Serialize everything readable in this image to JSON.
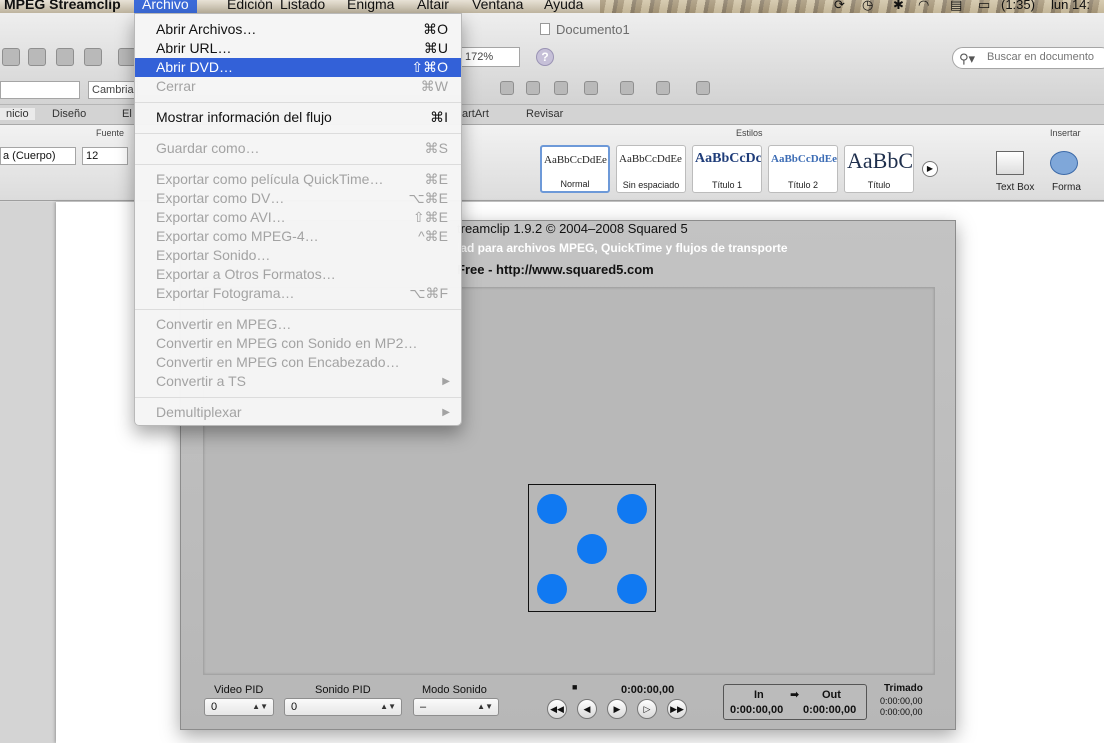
{
  "menubar": {
    "app": "MPEG Streamclip",
    "items": [
      "Archivo",
      "Edición",
      "Listado",
      "Enigma",
      "Altair",
      "Ventana",
      "Ayuda"
    ],
    "battery": "(1:35)",
    "clock": "lun 14:"
  },
  "word": {
    "doc_title": "Documento1",
    "zoom": "172%",
    "search_placeholder": "Buscar en documento",
    "font_name": "Cambria",
    "font_name2": "a (Cuerpo)",
    "font_size": "12",
    "tabs": [
      "nicio",
      "Diseño",
      "El",
      "artArt",
      "Revisar"
    ],
    "group_fuente": "Fuente",
    "group_estilos": "Estilos",
    "group_insertar": "Insertar",
    "styles": [
      {
        "sample": "AaBbCcDdEe",
        "caption": "Normal"
      },
      {
        "sample": "AaBbCcDdEe",
        "caption": "Sin espaciado"
      },
      {
        "sample": "AaBbCcDc",
        "caption": "Título 1"
      },
      {
        "sample": "AaBbCcDdEe",
        "caption": "Título 2"
      },
      {
        "sample": "AaBbC",
        "caption": "Título"
      }
    ],
    "insert_textbox": "Text Box",
    "insert_forma": "Forma"
  },
  "streamclip": {
    "line1": "treamclip 1.9.2 © 2004–2008 Squared 5",
    "line2": "lad para archivos MPEG, QuickTime y flujos de transporte",
    "line3": "Free  -  http://www.squared5.com",
    "video_pid_label": "Video PID",
    "video_pid_value": "0",
    "audio_pid_label": "Sonido PID",
    "audio_pid_value": "0",
    "audio_mode_label": "Modo Sonido",
    "audio_mode_value": "–",
    "timecode": "0:00:00,00",
    "in_label": "In",
    "out_label": "Out",
    "in_value": "0:00:00,00",
    "out_value": "0:00:00,00",
    "trim_label": "Trimado",
    "trim_value1": "0:00:00,00",
    "trim_value2": "0:00:00,00",
    "pip_color": "#1079f2"
  },
  "file_menu": {
    "items": [
      {
        "label": "Abrir Archivos…",
        "shortcut": "⌘O",
        "state": "enabled"
      },
      {
        "label": "Abrir URL…",
        "shortcut": "⌘U",
        "state": "enabled"
      },
      {
        "label": "Abrir DVD…",
        "shortcut": "⇧⌘O",
        "state": "highlighted"
      },
      {
        "label": "Cerrar",
        "shortcut": "⌘W",
        "state": "disabled"
      },
      {
        "label": "Mostrar información del flujo",
        "shortcut": "⌘I",
        "state": "enabled"
      },
      {
        "label": "Guardar como…",
        "shortcut": "⌘S",
        "state": "disabled"
      },
      {
        "label": "Exportar como película QuickTime…",
        "shortcut": "⌘E",
        "state": "disabled"
      },
      {
        "label": "Exportar como DV…",
        "shortcut": "⌥⌘E",
        "state": "disabled"
      },
      {
        "label": "Exportar como AVI…",
        "shortcut": "⇧⌘E",
        "state": "disabled"
      },
      {
        "label": "Exportar como MPEG-4…",
        "shortcut": "^⌘E",
        "state": "disabled"
      },
      {
        "label": "Exportar Sonido…",
        "shortcut": "",
        "state": "disabled"
      },
      {
        "label": "Exportar a Otros Formatos…",
        "shortcut": "",
        "state": "disabled"
      },
      {
        "label": "Exportar Fotograma…",
        "shortcut": "⌥⌘F",
        "state": "disabled"
      },
      {
        "label": "Convertir en MPEG…",
        "shortcut": "",
        "state": "disabled"
      },
      {
        "label": "Convertir en MPEG con Sonido en MP2…",
        "shortcut": "",
        "state": "disabled"
      },
      {
        "label": "Convertir en MPEG con Encabezado…",
        "shortcut": "",
        "state": "disabled"
      },
      {
        "label": "Convertir a TS",
        "shortcut": "",
        "state": "disabled",
        "submenu": true
      },
      {
        "label": "Demultiplexar",
        "shortcut": "",
        "state": "disabled",
        "submenu": true
      }
    ],
    "submenu_arrow": "▶",
    "highlight_color": "#3361d8"
  }
}
